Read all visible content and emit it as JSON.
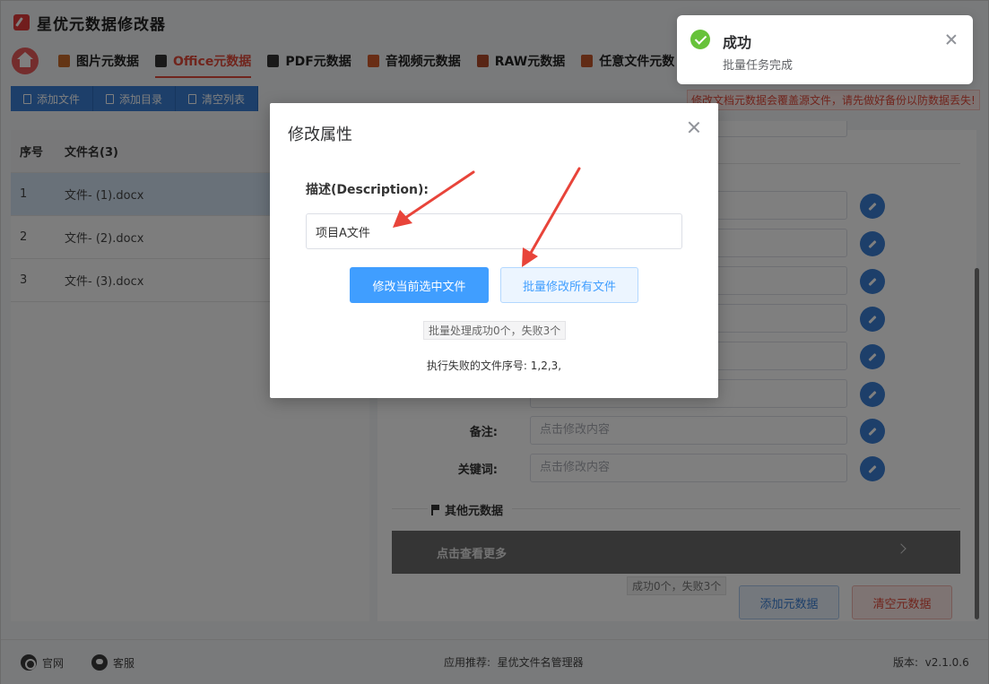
{
  "app": {
    "title": "星优元数据修改器"
  },
  "nav": {
    "tabs": [
      {
        "label": "图片元数据",
        "icon": "image-icon",
        "color": "#c86a2a"
      },
      {
        "label": "Office元数据",
        "icon": "office-icon",
        "color": "#333333"
      },
      {
        "label": "PDF元数据",
        "icon": "pdf-icon",
        "color": "#333333"
      },
      {
        "label": "音视频元数据",
        "icon": "media-icon",
        "color": "#d35a2a"
      },
      {
        "label": "RAW元数据",
        "icon": "raw-icon",
        "color": "#b04a2a"
      },
      {
        "label": "任意文件元数",
        "icon": "file-icon",
        "color": "#c2562a"
      }
    ],
    "active_index": 1
  },
  "toolbar": {
    "add_file": "添加文件",
    "add_dir": "添加目录",
    "clear_list": "清空列表",
    "warning": "修改文档元数据会覆盖源文件，请先做好备份以防数据丢失!"
  },
  "table": {
    "headers": [
      "序号",
      "文件名(3)"
    ],
    "rows": [
      {
        "index": "1",
        "name": "文件- (1).docx"
      },
      {
        "index": "2",
        "name": "文件- (2).docx"
      },
      {
        "index": "3",
        "name": "文件- (3).docx"
      }
    ]
  },
  "fields": {
    "remark_label": "备注:",
    "remark_placeholder": "点击修改内容",
    "keywords_label": "关键词:",
    "keywords_placeholder": "点击修改内容"
  },
  "other": {
    "title": "其他元数据",
    "more": "点击查看更多",
    "status": "成功0个，失败3个",
    "add_meta": "添加元数据",
    "clear_meta": "清空元数据"
  },
  "footer": {
    "website": "官网",
    "support": "客服",
    "recommend": "应用推荐:  星优文件名管理器",
    "version": "版本:  v2.1.0.6"
  },
  "dialog": {
    "title": "修改属性",
    "label": "描述(Description):",
    "value": "项目A文件",
    "btn_current": "修改当前选中文件",
    "btn_batch": "批量修改所有文件",
    "result": "批量处理成功0个，失败3个",
    "fail_ids": "执行失败的文件序号: 1,2,3,"
  },
  "toast": {
    "title": "成功",
    "message": "批量任务完成"
  },
  "colors": {
    "accent_red": "#e04a3a",
    "primary_blue": "#409eff",
    "toolbar_blue": "#3b7fd4",
    "success_green": "#67c23a"
  }
}
